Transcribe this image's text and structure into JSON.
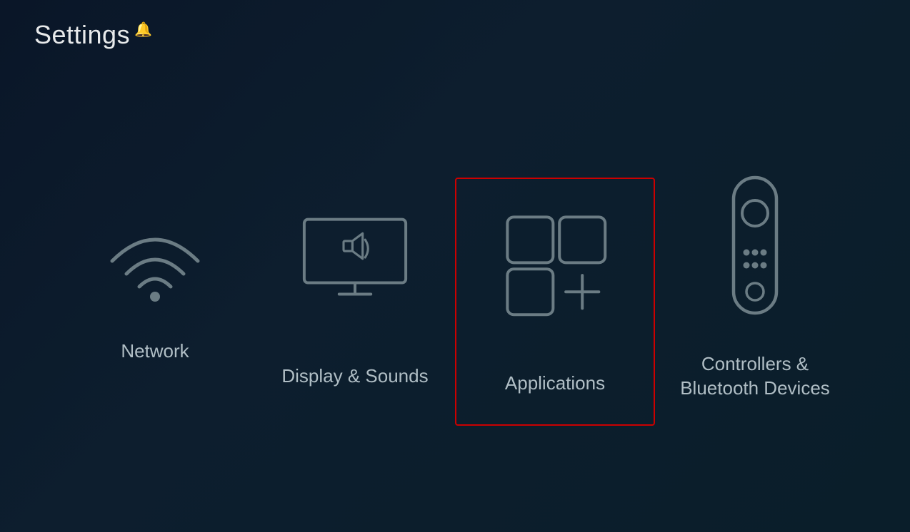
{
  "page": {
    "title": "Settings",
    "notification": "🔔"
  },
  "items": [
    {
      "id": "network",
      "label": "Network",
      "selected": false
    },
    {
      "id": "display-sounds",
      "label": "Display & Sounds",
      "selected": false
    },
    {
      "id": "applications",
      "label": "Applications",
      "selected": true
    },
    {
      "id": "controllers",
      "label": "Controllers &\nBluetooth Devices",
      "selected": false
    }
  ],
  "colors": {
    "background": "#0a1628",
    "icon_stroke": "#6b7c84",
    "selected_border": "#cc0000",
    "label_color": "#b0bec5",
    "title_color": "#e8eaeb"
  }
}
